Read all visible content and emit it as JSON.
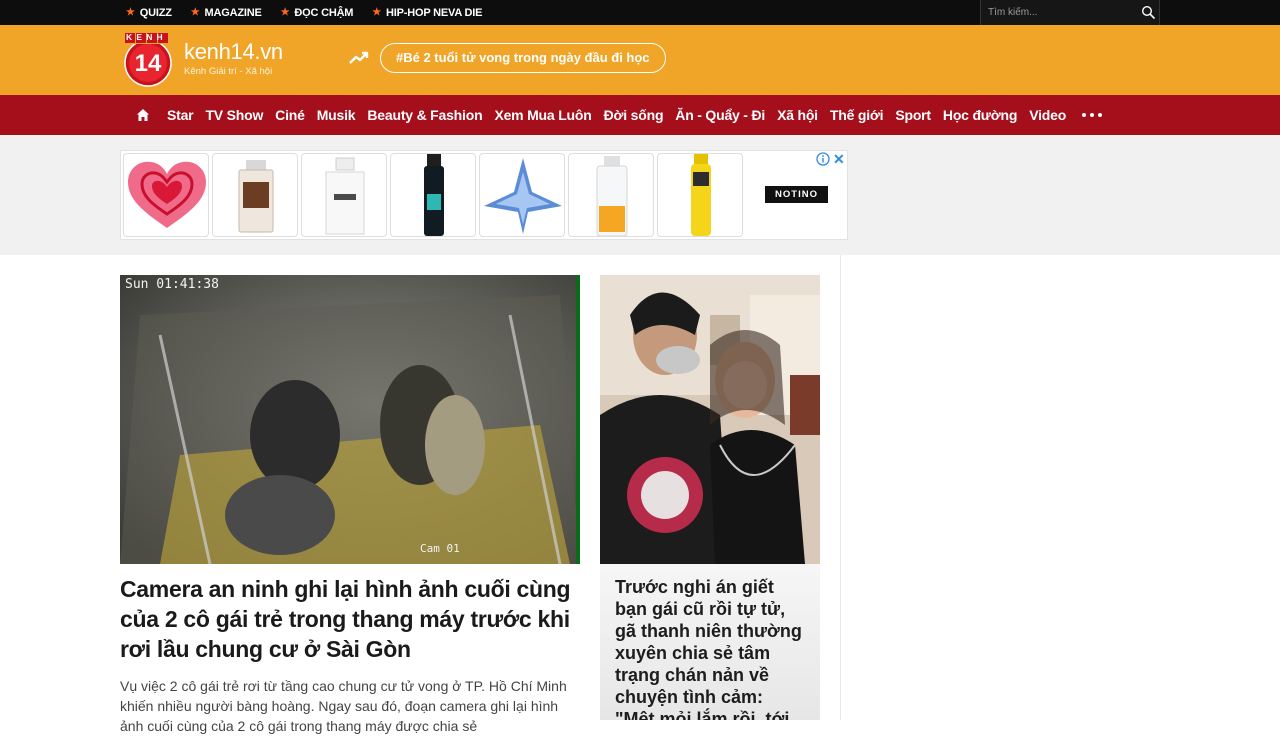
{
  "topbar": {
    "links": [
      {
        "label": "QUIZZ"
      },
      {
        "label": "MAGAZINE"
      },
      {
        "label": "ĐỌC CHẬM"
      },
      {
        "label": "HIP-HOP NEVA DIE"
      }
    ],
    "search": {
      "placeholder": "Tìm kiếm...",
      "icon": "search-icon"
    },
    "star_color": "#ff6a1f"
  },
  "header": {
    "logo_top": "KENH",
    "logo_number": "14",
    "brand": "kenh14.vn",
    "tagline": "Kênh Giải trí - Xã hội",
    "trending_icon": "trending-up-icon",
    "hashtag": "#Bé 2 tuổi tử vong trong ngày đầu đi học",
    "background": "#f0a528"
  },
  "nav": {
    "home_icon": "home-icon",
    "items": [
      {
        "label": "Star"
      },
      {
        "label": "TV Show"
      },
      {
        "label": "Ciné"
      },
      {
        "label": "Musik"
      },
      {
        "label": "Beauty & Fashion"
      },
      {
        "label": "Xem Mua Luôn"
      },
      {
        "label": "Đời sống"
      },
      {
        "label": "Ăn - Quẩy - Đi"
      },
      {
        "label": "Xã hội"
      },
      {
        "label": "Thế giới"
      },
      {
        "label": "Sport"
      },
      {
        "label": "Học đường"
      },
      {
        "label": "Video"
      }
    ],
    "more_icon": "more-dots-icon",
    "background": "#a50e1b"
  },
  "ad": {
    "brand": "NOTINO",
    "info_icon": "ad-info-icon",
    "close_icon": "close-icon",
    "close_label": "✕",
    "products": [
      "heart-perfume",
      "amber-perfume",
      "white-perfume",
      "dark-spray",
      "blue-star-perfume",
      "sun-perfume",
      "yellow-spray"
    ]
  },
  "main": {
    "hero": {
      "image_caption": "Sun 01:41:38",
      "image_watermark": "Cam 01",
      "title": "Camera an ninh ghi lại hình ảnh cuối cùng của 2 cô gái trẻ trong thang máy trước khi rơi lầu chung cư ở Sài Gòn",
      "sapo": "Vụ việc 2 cô gái trẻ rơi từ tầng cao chung cư tử vong ở TP. Hồ Chí Minh khiến nhiều người bàng hoàng. Ngay sau đó, đoạn camera ghi lại hình ảnh cuối cùng của 2 cô gái trong thang máy được chia sẻ"
    },
    "side": {
      "title": "Trước nghi án giết bạn gái cũ rồi tự tử, gã thanh niên thường xuyên chia sẻ tâm trạng chán nản về chuyện tình cảm: \"Mệt mỏi lắm rồi, tới lúc phải kết thúc\""
    }
  }
}
